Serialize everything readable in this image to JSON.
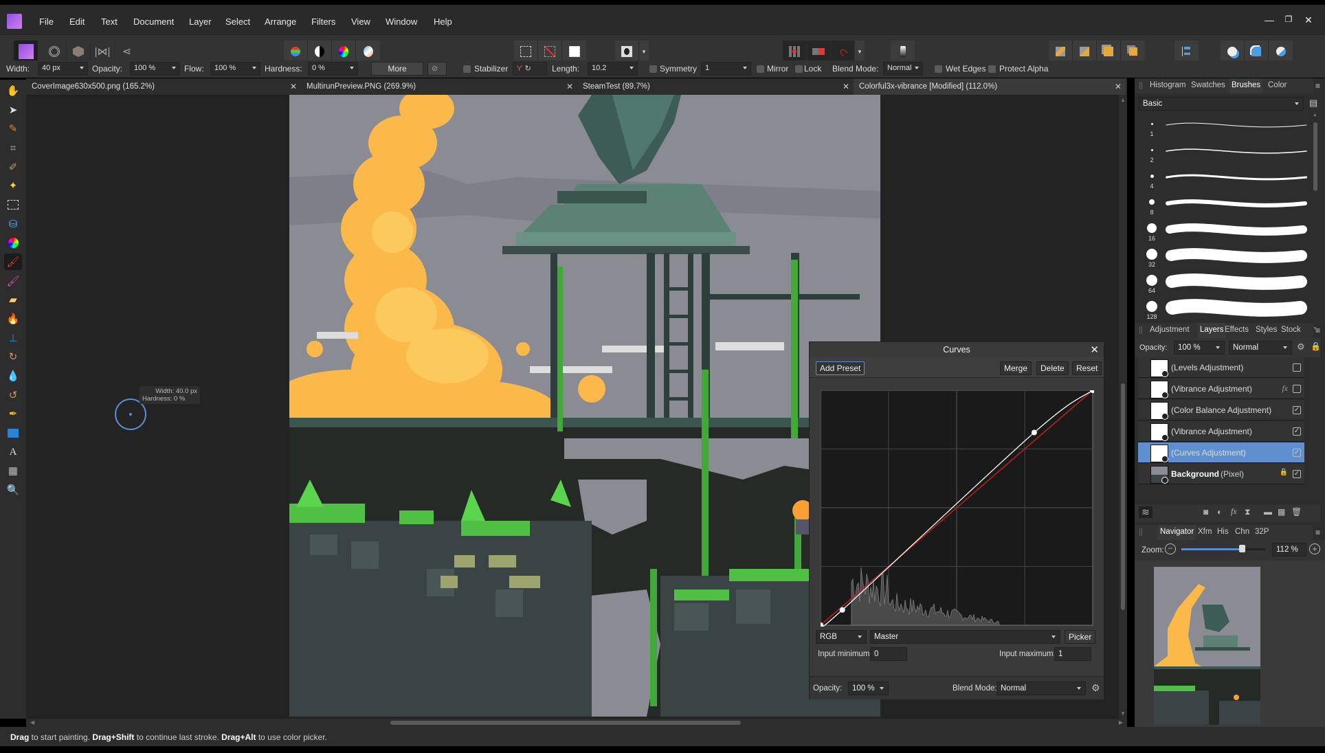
{
  "app": {
    "name": "Affinity Photo"
  },
  "menu": [
    "File",
    "Edit",
    "Text",
    "Document",
    "Layer",
    "Select",
    "Arrange",
    "Filters",
    "View",
    "Window",
    "Help"
  ],
  "window_controls": {
    "minimize": "—",
    "restore": "❐",
    "close": "✕"
  },
  "toolbar": {
    "personas": [
      "photo-persona",
      "liquify-persona",
      "develop-persona",
      "tone-mapping-persona",
      "export-persona"
    ],
    "adjust_buttons": [
      "auto-levels",
      "auto-contrast",
      "auto-colors",
      "auto-white-balance"
    ],
    "selection_buttons": [
      "marquee-selection",
      "deselect",
      "invert-selection"
    ],
    "mask_button": "quick-mask",
    "snap_buttons": [
      "grid",
      "force-pixel-alignment",
      "snapping"
    ],
    "assistant_button": "assistant",
    "arrange_buttons": [
      "move-to-back",
      "move-back-one",
      "move-forward-one",
      "move-to-front"
    ],
    "align_button": "align",
    "boolean_buttons": [
      "add",
      "subtract",
      "intersect"
    ]
  },
  "context": {
    "width_label": "Width:",
    "width_value": "40 px",
    "opacity_label": "Opacity:",
    "opacity_value": "100 %",
    "flow_label": "Flow:",
    "flow_value": "100 %",
    "hardness_label": "Hardness:",
    "hardness_value": "0 %",
    "more_label": "More",
    "stabilizer_label": "Stabilizer",
    "stabilizer_checked": false,
    "length_label": "Length:",
    "length_value": "10.2",
    "symmetry_label": "Symmetry",
    "symmetry_value": "1",
    "mirror_label": "Mirror",
    "lock_label": "Lock",
    "blend_label": "Blend Mode:",
    "blend_value": "Normal",
    "wet_edges_label": "Wet Edges",
    "protect_alpha_label": "Protect Alpha"
  },
  "tools": [
    "hand",
    "move",
    "color-picker",
    "crop",
    "selection-brush",
    "flood-select",
    "marquee",
    "flood-fill",
    "color-replacement",
    "paint-brush",
    "pixel-brush",
    "erase-brush",
    "dodge-brush",
    "clone-brush",
    "inpainting-brush",
    "blur-brush",
    "mixer-brush",
    "pen",
    "rectangle",
    "artistic-text",
    "mesh-warp",
    "zoom"
  ],
  "tools_active": "paint-brush",
  "doc_tabs": [
    {
      "label": "CoverImage630x500.png (165.2%)",
      "active": false
    },
    {
      "label": "MultirunPreview.PNG (269.9%)",
      "active": false
    },
    {
      "label": "SteamTest (89.7%)",
      "active": false
    },
    {
      "label": "Colorful3x-vibrance [Modified] (112.0%)",
      "active": true
    }
  ],
  "brush_cursor_tooltip": {
    "width": "Width: 40.0 px",
    "hardness": "Hardness: 0 %"
  },
  "status_bar": {
    "k1": "Drag",
    "t1": " to start painting. ",
    "k2": "Drag+Shift",
    "t2": " to continue last stroke. ",
    "k3": "Drag+Alt",
    "t3": " to use color picker."
  },
  "top_panel": {
    "tabs": [
      "Histogram",
      "Swatches",
      "Brushes",
      "Color"
    ],
    "active_tab": "Brushes",
    "category": "Basic",
    "brushes": [
      {
        "size": "1"
      },
      {
        "size": "2"
      },
      {
        "size": "4"
      },
      {
        "size": "8"
      },
      {
        "size": "16"
      },
      {
        "size": "32"
      },
      {
        "size": "64"
      },
      {
        "size": "128"
      }
    ]
  },
  "layers_panel": {
    "tabs": [
      "Adjustment",
      "Layers",
      "Effects",
      "Styles",
      "Stock"
    ],
    "active_tab": "Layers",
    "opacity_label": "Opacity:",
    "opacity_value": "100 %",
    "blend_value": "Normal",
    "layers": [
      {
        "name": "(Levels Adjustment)",
        "visible": false,
        "fx": false,
        "selected": false
      },
      {
        "name": "(Vibrance Adjustment)",
        "visible": false,
        "fx": true,
        "selected": false
      },
      {
        "name": "(Color Balance Adjustment)",
        "visible": true,
        "fx": false,
        "selected": false
      },
      {
        "name": "(Vibrance Adjustment)",
        "visible": true,
        "fx": false,
        "selected": false
      },
      {
        "name": "(Curves Adjustment)",
        "visible": true,
        "fx": false,
        "selected": true
      },
      {
        "name": "Background",
        "type": "(Pixel)",
        "visible": true,
        "locked": true,
        "selected": false
      }
    ],
    "fx_label": "fx"
  },
  "navigator_panel": {
    "tabs": [
      "Navigator",
      "Xfm",
      "His",
      "Chn",
      "32P"
    ],
    "active_tab": "Navigator",
    "zoom_label": "Zoom:",
    "zoom_value": "112 %",
    "zoom_slider_fraction": 0.72
  },
  "curves_dialog": {
    "title": "Curves",
    "add_preset": "Add Preset",
    "merge": "Merge",
    "delete": "Delete",
    "reset": "Reset",
    "channel": "RGB",
    "mode": "Master",
    "picker": "Picker",
    "input_min_label": "Input minimum:",
    "input_min_value": "0",
    "input_max_label": "Input maximum:",
    "input_max_value": "1",
    "opacity_label": "Opacity:",
    "opacity_value": "100 %",
    "blend_label": "Blend Mode:",
    "blend_value": "Normal",
    "control_points": [
      [
        0,
        0
      ],
      [
        0.08,
        0.065
      ],
      [
        0.785,
        0.82
      ],
      [
        1,
        1
      ]
    ],
    "colors": {
      "curve": "#ffffff",
      "baseline": "#c02020"
    }
  }
}
